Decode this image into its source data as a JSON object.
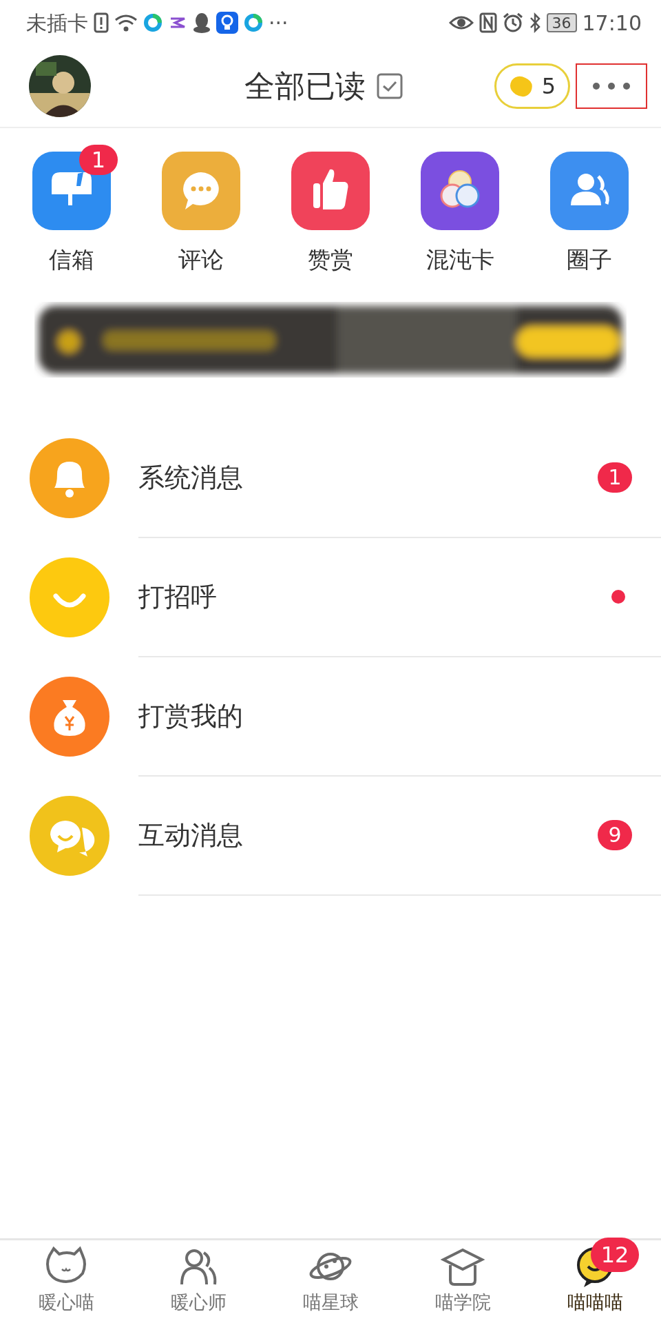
{
  "status_bar": {
    "carrier": "未插卡",
    "more": "···",
    "battery": "36",
    "time": "17:10"
  },
  "header": {
    "title": "全部已读",
    "coins": "5"
  },
  "shortcuts": [
    {
      "label": "信箱",
      "kind": "mailbox",
      "badge": "1"
    },
    {
      "label": "评论",
      "kind": "comment"
    },
    {
      "label": "赞赏",
      "kind": "thumb"
    },
    {
      "label": "混沌卡",
      "kind": "circles"
    },
    {
      "label": "圈子",
      "kind": "people"
    }
  ],
  "messages": [
    {
      "label": "系统消息",
      "kind": "bell",
      "badge": "1",
      "dot": false
    },
    {
      "label": "打招呼",
      "kind": "smile",
      "dot": true
    },
    {
      "label": "打赏我的",
      "kind": "moneybag",
      "dot": false
    },
    {
      "label": "互动消息",
      "kind": "chat",
      "badge": "9",
      "dot": false
    }
  ],
  "tabs": [
    {
      "label": "暖心喵",
      "kind": "cat",
      "selected": false
    },
    {
      "label": "暖心师",
      "kind": "people",
      "selected": false
    },
    {
      "label": "喵星球",
      "kind": "planet",
      "selected": false
    },
    {
      "label": "喵学院",
      "kind": "cap",
      "selected": false
    },
    {
      "label": "喵喵喵",
      "kind": "chat",
      "selected": true,
      "badge": "12"
    }
  ]
}
